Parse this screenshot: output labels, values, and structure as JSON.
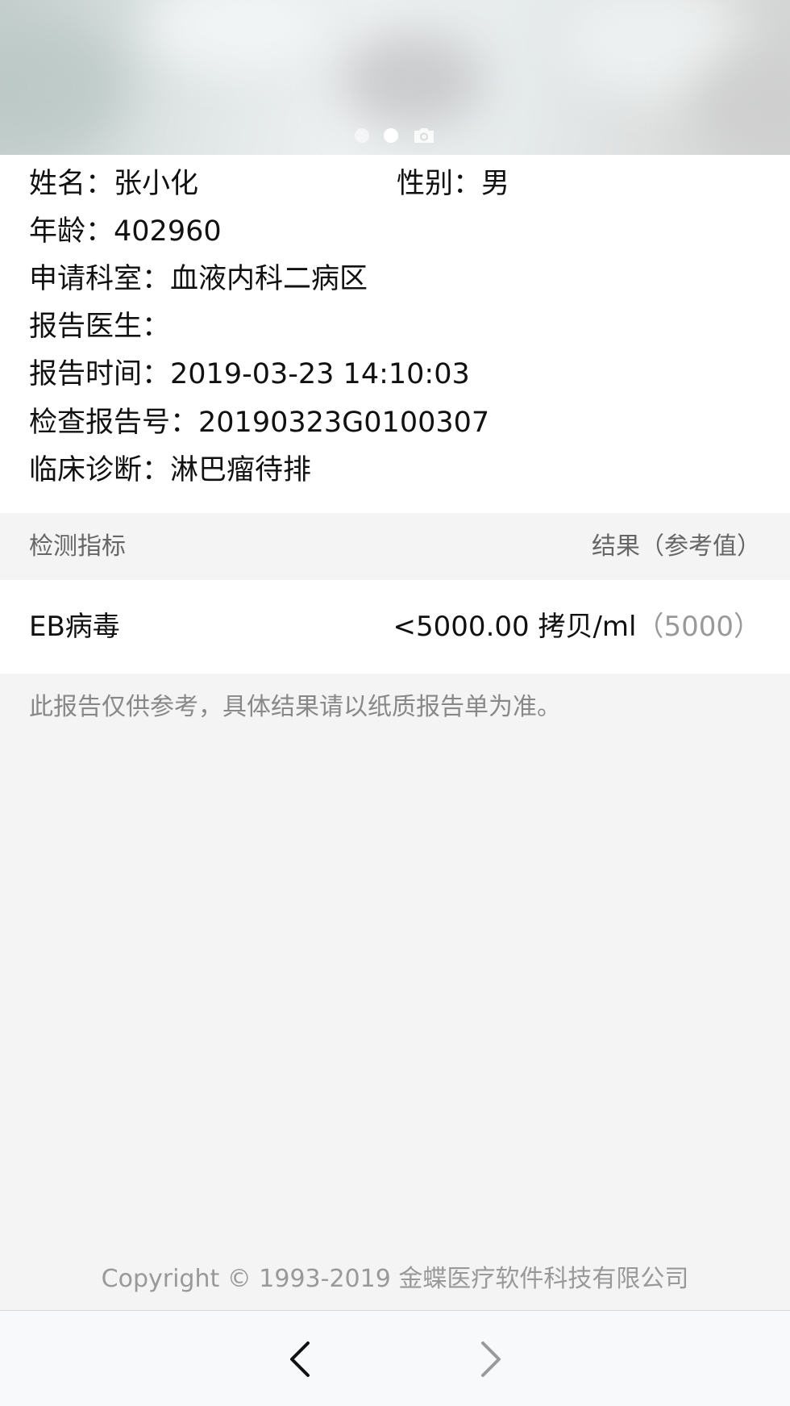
{
  "banner": {
    "indicators": [
      {
        "type": "dot",
        "active": false
      },
      {
        "type": "dot",
        "active": true
      },
      {
        "type": "icon",
        "icon": "camera-icon",
        "active": false
      }
    ]
  },
  "patient": {
    "name_label": "姓名：",
    "name": "张小化",
    "gender_label": "性别：",
    "gender": "男",
    "age_label": "年龄：",
    "age": "402960",
    "department_label": "申请科室：",
    "department": "血液内科二病区",
    "doctor_label": "报告医生：",
    "doctor": "",
    "report_time_label": "报告时间：",
    "report_time": "2019-03-23 14:10:03",
    "report_no_label": "检查报告号：",
    "report_no": "20190323G0100307",
    "diagnosis_label": "临床诊断：",
    "diagnosis": "淋巴瘤待排"
  },
  "results_table": {
    "header_left": "检测指标",
    "header_right": "结果（参考值）",
    "rows": [
      {
        "name": "EB病毒",
        "value": "<5000.00 拷贝/ml",
        "reference": "（5000）"
      }
    ]
  },
  "note": "此报告仅供参考，具体结果请以纸质报告单为准。",
  "footer": {
    "copyright": "Copyright © 1993-2019 金蝶医疗软件科技有限公司"
  },
  "navigation": {
    "back_icon": "chevron-left-icon",
    "forward_icon": "chevron-right-icon",
    "back_color": "#111111",
    "forward_color": "#9a9a9a"
  }
}
